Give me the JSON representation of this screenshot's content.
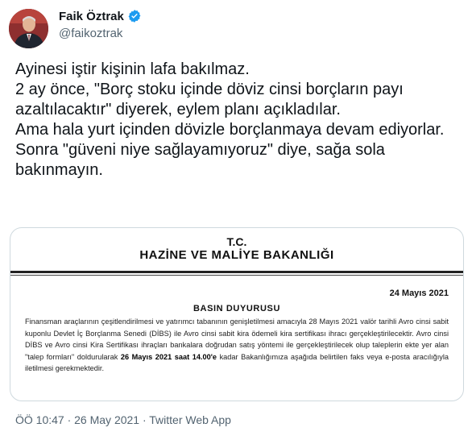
{
  "author": {
    "name": "Faik Öztrak",
    "handle": "@faikoztrak",
    "verified": true,
    "verified_icon": "verified-badge-icon",
    "accent_color": "#1d9bf0"
  },
  "tweet": {
    "text": "Ayinesi iştir kişinin lafa bakılmaz.\n2 ay önce, \"Borç stoku içinde döviz cinsi borçların payı azaltılacaktır\" diyerek, eylem planı açıkladılar.\nAma hala yurt içinden dövizle borçlanmaya devam ediyorlar.\nSonra \"güveni niye sağlayamıyoruz\" diye, sağa sola bakınmayın."
  },
  "media": {
    "tc": "T.C.",
    "ministry": "HAZİNE VE MALİYE BAKANLIĞI",
    "date": "24 Mayıs 2021",
    "heading": "BASIN DUYURUSU",
    "para_start": "Finansman araçlarının çeşitlendirilmesi ve yatırımcı tabanının genişletilmesi amacıyla 28 Mayıs 2021 valör tarihli Avro cinsi sabit kuponlu Devlet İç Borçlanma Senedi (DİBS) ile Avro cinsi sabit kira ödemeli kira sertifikası ihracı gerçekleştirilecektir. Avro cinsi DİBS ve Avro cinsi Kira Sertifikası ihraçları bankalara doğrudan satış yöntemi ile gerçekleştirilecek olup taleplerin ekte yer alan \"talep formları\" doldurularak ",
    "para_bold": "26 Mayıs 2021 saat 14.00'e",
    "para_end": " kadar Bakanlığımıza aşağıda belirtilen faks veya e-posta aracılığıyla iletilmesi gerekmektedir."
  },
  "meta": {
    "timestamp": "ÖÖ 10:47 · 26 May 2021 · Twitter Web App"
  }
}
